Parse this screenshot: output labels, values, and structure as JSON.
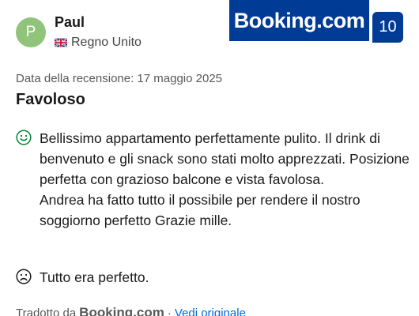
{
  "reviewer": {
    "initial": "P",
    "name": "Paul",
    "country": "Regno Unito",
    "flag_icon": "uk-flag-icon",
    "avatar_color": "#8fc47a"
  },
  "brand": {
    "logo_text": "Booking.com",
    "color": "#003b95"
  },
  "score": "10",
  "review": {
    "date_label": "Data della recensione: 17 maggio 2025",
    "title": "Favoloso",
    "positive_icon": "smile-icon",
    "positive_text": "Bellissimo appartamento perfettamente pulito. Il drink di benvenuto e gli snack sono stati molto apprezzati. Posizione perfetta con grazioso balcone e vista favolosa.\nAndrea ha fatto tutto il possibile per rendere il nostro soggiorno perfetto Grazie mille.",
    "negative_icon": "frown-icon",
    "negative_text": "Tutto era perfetto."
  },
  "translation": {
    "prefix": "Tradotto da",
    "brand": "Booking.com",
    "separator": "·",
    "link": "Vedi originale",
    "link_color": "#006ce4"
  }
}
